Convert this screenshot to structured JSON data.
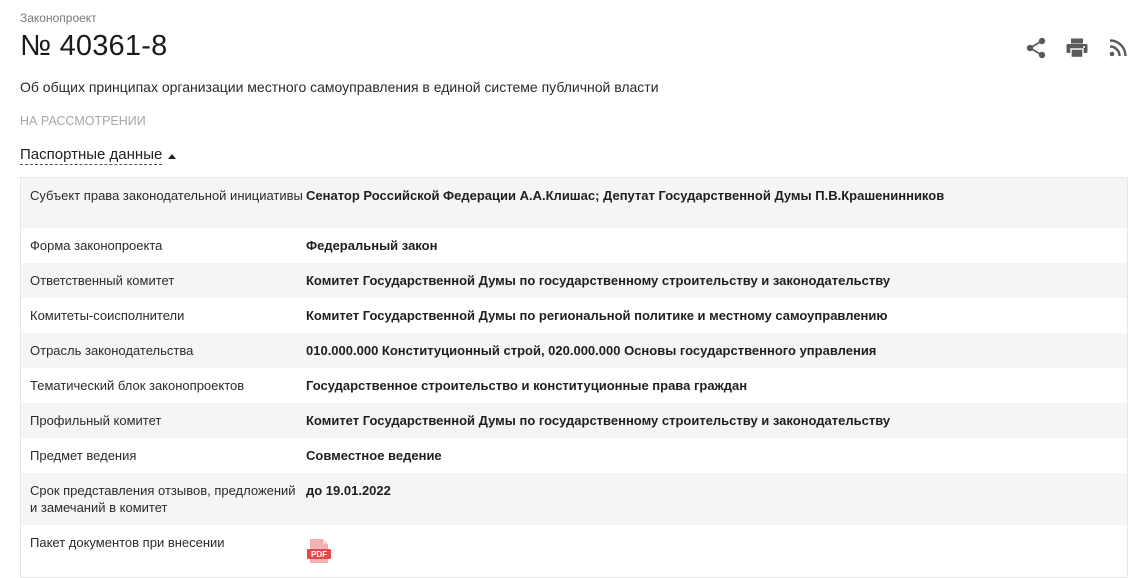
{
  "header": {
    "overline": "Законопроект",
    "number": "№ 40361-8",
    "title": "Об общих принципах организации местного самоуправления в единой системе публичной власти",
    "status": "НА РАССМОТРЕНИИ"
  },
  "actions": {
    "share_icon": "share-icon",
    "print_icon": "print-icon",
    "rss_icon": "rss-icon"
  },
  "section": {
    "label": "Паспортные данные",
    "state": "expanded"
  },
  "passport": {
    "rows": [
      {
        "label": "Субъект права законодательной инициативы",
        "value": "Сенатор Российской Федерации А.А.Клишас; Депутат Государственной Думы П.В.Крашенинников"
      },
      {
        "label": "Форма законопроекта",
        "value": "Федеральный закон"
      },
      {
        "label": "Ответственный комитет",
        "value": "Комитет Государственной Думы по государственному строительству и законодательству"
      },
      {
        "label": "Комитеты-соисполнители",
        "value": "Комитет Государственной Думы по региональной политике и местному самоуправлению"
      },
      {
        "label": "Отрасль законодательства",
        "value": "010.000.000 Конституционный строй, 020.000.000 Основы государственного управления"
      },
      {
        "label": "Тематический блок законопроектов",
        "value": "Государственное строительство и конституционные права граждан"
      },
      {
        "label": "Профильный комитет",
        "value": "Комитет Государственной Думы по государственному строительству и законодательству"
      },
      {
        "label": "Предмет ведения",
        "value": "Совместное ведение"
      },
      {
        "label": "Срок представления отзывов, предложений и замечаний в комитет",
        "value": "до 19.01.2022"
      },
      {
        "label": "Пакет документов при внесении",
        "value": ""
      }
    ],
    "pdf_badge": "PDF"
  },
  "colors": {
    "accent_pdf": "#e8474a",
    "icon_gray": "#5a5a5a",
    "status_gray": "#a8a8a8"
  }
}
